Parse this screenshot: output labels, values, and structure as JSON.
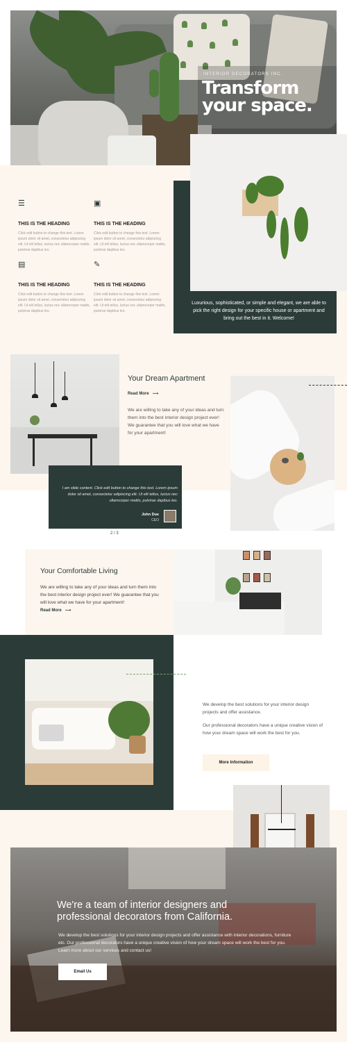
{
  "hero": {
    "eyebrow": "INTERIOR DECORATORS INC.",
    "title": "Transform your space."
  },
  "features": [
    {
      "icon": "stack-icon",
      "heading": "THIS IS THE HEADING",
      "text": "Click edit button to change this text. Lorem ipsum dolor sit amet, consectetur adipiscing elit. Ut elit tellus, luctus nec ullamcorper mattis, pulvinar dapibus leo."
    },
    {
      "icon": "slideshare-icon",
      "heading": "THIS IS THE HEADING",
      "text": "Click edit button to change this text. Lorem ipsum dolor sit amet, consectetur adipiscing elit. Ut elit tellus, luctus nec ullamcorper mattis, pulvinar dapibus leo."
    },
    {
      "icon": "archive-icon",
      "heading": "THIS IS THE HEADING",
      "text": "Click edit button to change this text. Lorem ipsum dolor sit amet, consectetur adipiscing elit. Ut elit tellus, luctus nec ullamcorper mattis, pulvinar dapibus leo."
    },
    {
      "icon": "edit-icon",
      "heading": "THIS IS THE HEADING",
      "text": "Click edit button to change this text. Lorem ipsum dolor sit amet, consectetur adipiscing elit. Ut elit tellus, luctus nec ullamcorper mattis, pulvinar dapibus leo."
    }
  ],
  "welcome": "Luxurious, sophisticated, or simple and elegant, we are able to pick the right design for your specific house or apartment and bring out the best in it. Welcome!",
  "apartment": {
    "title": "Your Dream Apartment",
    "read_more": "Read More",
    "text": "We are willing to take any of your ideas and turn them into the best interior design project ever! We guarantee that you will love what we have for your apartment!"
  },
  "testimonial": {
    "quote": "I am slide content. Click edit button to change this text. Lorem ipsum dolor sit amet, consectetur adipiscing elit. Ut elit tellus, luctus nec ullamcorper mattis, pulvinar dapibus leo.",
    "name": "John Doe",
    "role": "CEO",
    "pager": "2 / 3"
  },
  "comfort": {
    "title": "Your Comfortable Living",
    "text": "We are willing to take any of your ideas and turn them into the best interior design project ever! We guarantee that you will love what we have for your apartment!",
    "read_more": "Read More"
  },
  "develop": {
    "text1": "We develop the best solutions for your interior design projects and offer assistance.",
    "text2": "Our professional decorators have a unique creative vision of how your dream space will work the best for you.",
    "button": "More Information"
  },
  "team": {
    "title": "We're a team of interior designers and professional decorators from California.",
    "text": "We develop the best solutions for your interior design projects and offer assistance with interior decorations, furniture etc. Our professional decorators have a unique creative vision of how your dream space will work the best for you. Learn more about our services and contact us!",
    "button": "Email Us"
  },
  "colors": {
    "dark_green": "#2b3b38",
    "cream": "#fdf6ee"
  }
}
